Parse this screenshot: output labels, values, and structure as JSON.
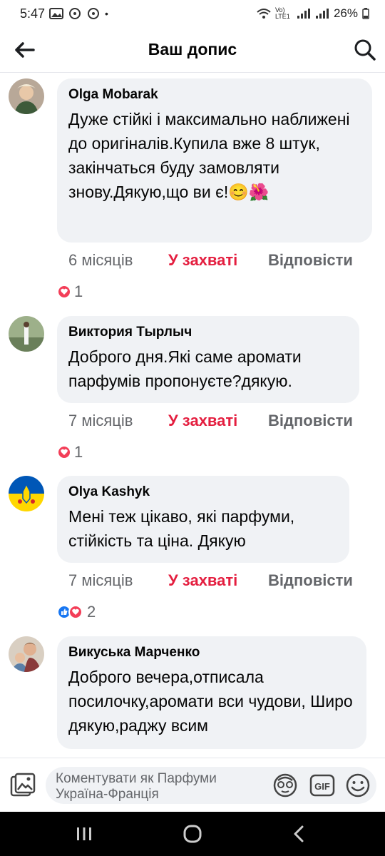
{
  "status_bar": {
    "time": "5:47",
    "battery": "26%",
    "network": "Vo) LTE1"
  },
  "header": {
    "title": "Ваш допис"
  },
  "comments": [
    {
      "author": "Olga Mobarak",
      "text": "Дуже стійкі і максимально наближені до оригіналів.Купила вже 8 штук, закінчаться буду замовляти знову.Дякую,що ви є!😊🌺",
      "time": "6 місяців",
      "liked_label": "У захваті",
      "reply_label": "Відповісти",
      "reaction_count": "1"
    },
    {
      "author": "Виктория Тырлыч",
      "text": "Доброго дня.Які саме аромати парфумів пропонуєте?дякую.",
      "time": "7 місяців",
      "liked_label": "У захваті",
      "reply_label": "Відповісти",
      "reaction_count": "1"
    },
    {
      "author": "Olya Kashyk",
      "text": "Мені теж цікаво, які парфуми, стійкість та ціна. Дякую",
      "time": "7 місяців",
      "liked_label": "У захваті",
      "reply_label": "Відповісти",
      "reaction_count": "2"
    },
    {
      "author": "Викуська Марченко",
      "text": "Доброго вечера,отписала посилочку,аромати вси чудови, Широ дякую,раджу всим"
    }
  ],
  "compose": {
    "placeholder": "Коментувати як Парфуми Україна-Франція"
  },
  "colors": {
    "liked": "#e41e3f",
    "bubble": "#f0f2f5",
    "secondary_text": "#65676b"
  }
}
